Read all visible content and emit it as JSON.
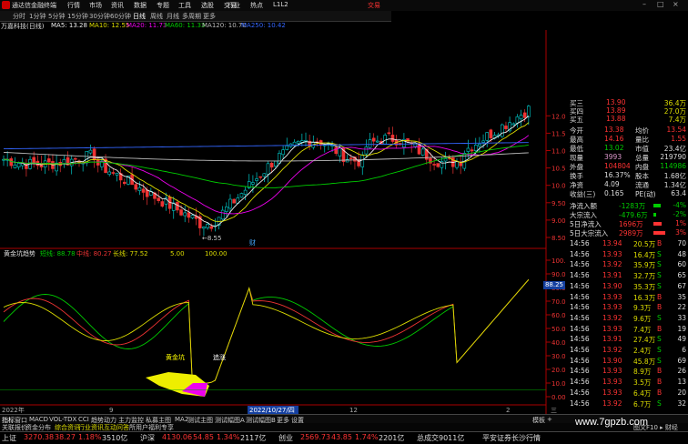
{
  "menubar": {
    "app_title": "通达信金融终端",
    "items": [
      "行情",
      "市场",
      "资讯",
      "数据",
      "专题",
      "工具",
      "选股",
      "交易",
      "行业",
      "热点",
      "L1L2"
    ],
    "brand": "交易",
    "window_controls": [
      "–",
      "□",
      "×"
    ]
  },
  "periods": [
    "分时",
    "1分钟",
    "5分钟",
    "15分钟",
    "30分钟",
    "60分钟",
    "日线",
    "周线",
    "月线",
    "多周期",
    "更多"
  ],
  "active_period": "日线",
  "legend": {
    "stock": "万嘉科技(日线)",
    "ma5": "MA5: 13.28",
    "ma10": "MA10: 12.55",
    "ma20": "MA20: 11.73",
    "ma60": "MA60: 11.33",
    "ma120": "MA120: 10.70",
    "ma250": "MA250: 10.42"
  },
  "price_axis": [
    "12.00",
    "11.50",
    "11.00",
    "10.50",
    "10.00",
    "9.50",
    "9.00",
    "8.50"
  ],
  "low_label": "←8.55",
  "finance_marker": "财",
  "indicator_legend": {
    "name": "黄金坑趋势",
    "green": "短线: 88.78",
    "red": "中线: 80.27",
    "yellow": "长线: 77.52",
    "level": "5.00",
    "level2": "100.00"
  },
  "ind_axis": [
    "100.00",
    "90.00",
    "80.00",
    "70.00",
    "60.00",
    "50.00",
    "40.00",
    "30.00",
    "20.00",
    "10.00",
    "0.00"
  ],
  "selected_value": "88.25",
  "annotations": {
    "buy": "黄金坑",
    "chase": "追涨"
  },
  "date_axis": {
    "start": "2022年",
    "m2": "9",
    "cursor_date": "2022/10/27/四",
    "m3": "12",
    "m4": "2",
    "end": "三"
  },
  "quote_panel": [
    {
      "l": "买三",
      "v": "13.90",
      "q": "36.4万"
    },
    {
      "l": "买四",
      "v": "13.89",
      "q": "27.0万"
    },
    {
      "l": "买五",
      "v": "13.88",
      "q": "7.4万"
    }
  ],
  "stats": [
    {
      "l1": "今开",
      "v1": "13.38",
      "l2": "均价",
      "v2": "13.54",
      "c1": "#f33",
      "c2": "#f33"
    },
    {
      "l1": "最高",
      "v1": "14.16",
      "l2": "量比",
      "v2": "1.55",
      "c1": "#f33",
      "c2": "#f33"
    },
    {
      "l1": "最低",
      "v1": "13.02",
      "l2": "市值",
      "v2": "23.4亿",
      "c1": "#0c0",
      "c2": "#ddd"
    },
    {
      "l1": "现量",
      "v1": "3993",
      "l2": "总量",
      "v2": "219790",
      "c1": "#d9c",
      "c2": "#ddd"
    },
    {
      "l1": "外盘",
      "v1": "104804",
      "l2": "内盘",
      "v2": "114986",
      "c1": "#f33",
      "c2": "#0c0"
    },
    {
      "l1": "换手",
      "v1": "16.37%",
      "l2": "股本",
      "v2": "1.68亿",
      "c1": "#ddd",
      "c2": "#ddd"
    },
    {
      "l1": "净资",
      "v1": "4.09",
      "l2": "流通",
      "v2": "1.34亿",
      "c1": "#ddd",
      "c2": "#ddd"
    },
    {
      "l1": "收益(三)",
      "v1": "0.165",
      "l2": "PE(动)",
      "v2": "63.4",
      "c1": "#ddd",
      "c2": "#ddd"
    }
  ],
  "flows": [
    {
      "l": "净流入额",
      "v": "-1283万",
      "p": "-4%",
      "c": "#0c0",
      "bar": 0.35
    },
    {
      "l": "大宗流入",
      "v": "-479.6万",
      "p": "-2%",
      "c": "#0c0",
      "bar": 0.15
    },
    {
      "l": "5日净流入",
      "v": "1696万",
      "p": "1%",
      "c": "#f33",
      "bar": 0.4
    },
    {
      "l": "5日大宗流入",
      "v": "2989万",
      "p": "3%",
      "c": "#f33",
      "bar": 0.6
    }
  ],
  "ticks": [
    {
      "t": "14:56",
      "p": "13.94",
      "v": "20.5万",
      "d": "B",
      "n": "70"
    },
    {
      "t": "14:56",
      "p": "13.93",
      "v": "16.4万",
      "d": "S",
      "n": "48"
    },
    {
      "t": "14:56",
      "p": "13.92",
      "v": "35.9万",
      "d": "S",
      "n": "60"
    },
    {
      "t": "14:56",
      "p": "13.91",
      "v": "32.7万",
      "d": "S",
      "n": "65"
    },
    {
      "t": "14:56",
      "p": "13.90",
      "v": "35.3万",
      "d": "S",
      "n": "67"
    },
    {
      "t": "14:56",
      "p": "13.93",
      "v": "16.3万",
      "d": "B",
      "n": "35"
    },
    {
      "t": "14:56",
      "p": "13.93",
      "v": "9.3万",
      "d": "B",
      "n": "22"
    },
    {
      "t": "14:56",
      "p": "13.92",
      "v": "9.6万",
      "d": "S",
      "n": "33"
    },
    {
      "t": "14:56",
      "p": "13.93",
      "v": "7.4万",
      "d": "B",
      "n": "19"
    },
    {
      "t": "14:56",
      "p": "13.91",
      "v": "27.4万",
      "d": "S",
      "n": "49"
    },
    {
      "t": "14:56",
      "p": "13.92",
      "v": "2.4万",
      "d": "S",
      "n": "6"
    },
    {
      "t": "14:56",
      "p": "13.90",
      "v": "45.8万",
      "d": "S",
      "n": "69"
    },
    {
      "t": "14:56",
      "p": "13.93",
      "v": "8.9万",
      "d": "B",
      "n": "26"
    },
    {
      "t": "14:56",
      "p": "13.93",
      "v": "3.5万",
      "d": "B",
      "n": "13"
    },
    {
      "t": "14:56",
      "p": "13.93",
      "v": "6.4万",
      "d": "B",
      "n": "20"
    },
    {
      "t": "14:56",
      "p": "13.92",
      "v": "6.7万",
      "d": "S",
      "n": "32"
    }
  ],
  "bottom_tabs": [
    "指标",
    "窗口",
    "MACD",
    "VOL-TDX",
    "CCI",
    "趋势动力",
    "主力监控",
    "私募主图",
    "MA2",
    "测试主图",
    "测试幅图A",
    "测试幅图B",
    "更多",
    "设置"
  ],
  "right_tabs": [
    "模板",
    "+"
  ],
  "tabs2": [
    "关联报价",
    "资金分布",
    "综合资讯",
    "行业资讯",
    "互动问答",
    "所用户福利专享"
  ],
  "tabs2_right": "图文F10 ▸ 财经",
  "status": [
    {
      "l": "上证",
      "v": "3270.38",
      "c": "38.27",
      "p": "1.18%",
      "a": "3510亿",
      "col": "#f33"
    },
    {
      "l": "沪深",
      "v": "4130.06",
      "c": "54.85",
      "p": "1.34%",
      "a": "2117亿",
      "col": "#f33"
    },
    {
      "l": "创业",
      "v": "2569.73",
      "c": "43.85",
      "p": "1.74%",
      "a": "2201亿",
      "col": "#f33"
    },
    {
      "l": "总成交",
      "v": "9011亿",
      "c": "",
      "p": "",
      "a": "",
      "col": "#ddd"
    }
  ],
  "status_tail": "平安证券长沙行情",
  "watermark": "www.7gpzb.com"
}
